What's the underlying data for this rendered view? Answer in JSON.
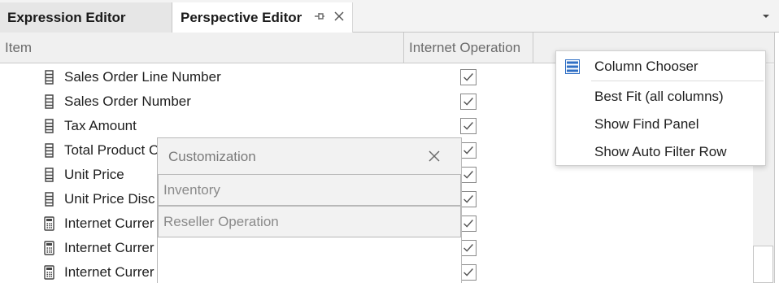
{
  "tabs": {
    "expression_editor": "Expression Editor",
    "perspective_editor": "Perspective Editor"
  },
  "grid": {
    "columns": [
      "Item",
      "Internet Operation"
    ],
    "rows": [
      {
        "label": "Sales Order Line Number",
        "icon": "column-icon",
        "checked": true
      },
      {
        "label": "Sales Order Number",
        "icon": "column-icon",
        "checked": true
      },
      {
        "label": "Tax Amount",
        "icon": "column-icon",
        "checked": true
      },
      {
        "label": "Total Product C",
        "icon": "column-icon",
        "checked": true
      },
      {
        "label": "Unit Price",
        "icon": "column-icon",
        "checked": true
      },
      {
        "label": "Unit Price Disc",
        "icon": "column-icon",
        "checked": true
      },
      {
        "label": "Internet Currer",
        "icon": "calculator-icon",
        "checked": true
      },
      {
        "label": "Internet Currer",
        "icon": "calculator-icon",
        "checked": true
      },
      {
        "label": "Internet Currer",
        "icon": "calculator-icon",
        "checked": true
      }
    ]
  },
  "context_menu": {
    "items": [
      "Column Chooser",
      "Best Fit (all columns)",
      "Show Find Panel",
      "Show Auto Filter Row"
    ]
  },
  "customization": {
    "title": "Customization",
    "items": [
      "Inventory",
      "Reseller Operation"
    ]
  },
  "colors": {
    "accent_blue": "#2f6fc4",
    "check_gray": "#555555"
  }
}
